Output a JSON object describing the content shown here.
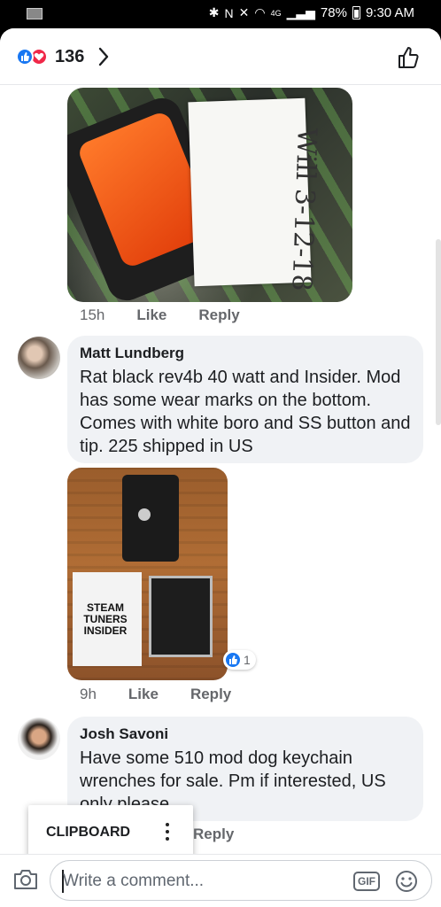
{
  "status_bar": {
    "battery": "78%",
    "time": "9:30 AM",
    "network": "4G"
  },
  "header": {
    "reaction_count": "136"
  },
  "comments": [
    {
      "time": "15h",
      "like_label": "Like",
      "reply_label": "Reply",
      "photo_note_text": "Will 3-12-18"
    },
    {
      "author": "Matt Lundberg",
      "text": "Rat black rev4b 40 watt and Insider. Mod has some wear marks on the bottom. Comes with white boro and SS button and tip. 225 shipped in US",
      "time": "9h",
      "like_label": "Like",
      "reply_label": "Reply",
      "reaction_badge_count": "1",
      "photo_card_text": "STEAM TUNERS INSIDER"
    },
    {
      "author": "Josh Savoni",
      "text": "Have some 510 mod dog keychain wrenches for sale. Pm if interested, US only please",
      "reply_label": "Reply"
    }
  ],
  "clipboard_popup": {
    "label": "CLIPBOARD"
  },
  "composer": {
    "placeholder": "Write a comment...",
    "gif_label": "GIF"
  },
  "icons": {
    "like": "thumbs-up-icon",
    "love": "heart-icon",
    "camera": "camera-icon",
    "emoji": "smiley-icon"
  },
  "colors": {
    "facebook_blue": "#1877f2",
    "love_red": "#f02849",
    "bubble_gray": "#f0f2f5",
    "meta_gray": "#65676b"
  }
}
